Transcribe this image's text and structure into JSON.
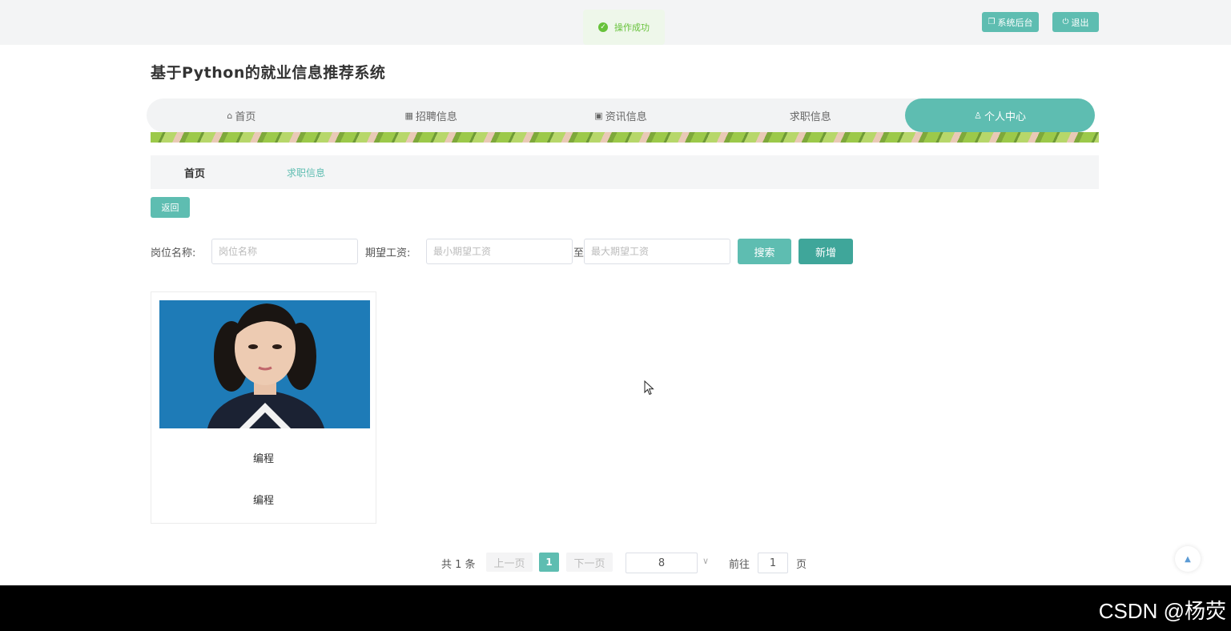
{
  "toast": {
    "text": "操作成功"
  },
  "header": {
    "admin_label": "系统后台",
    "logout_label": "退出"
  },
  "site_title": "基于Python的就业信息推荐系统",
  "nav": {
    "items": [
      {
        "label": "首页",
        "icon": "home-icon"
      },
      {
        "label": "招聘信息",
        "icon": "grid-icon"
      },
      {
        "label": "资讯信息",
        "icon": "briefcase-icon"
      },
      {
        "label": "求职信息",
        "icon": ""
      },
      {
        "label": "个人中心",
        "icon": "user-icon"
      }
    ],
    "active_index": 4,
    "active_color": "#5ebdb1"
  },
  "breadcrumb": {
    "home": "首页",
    "current": "求职信息"
  },
  "back_label": "返回",
  "search": {
    "job_label": "岗位名称:",
    "job_placeholder": "岗位名称",
    "salary_label": "期望工资:",
    "min_placeholder": "最小期望工资",
    "to_label": "至",
    "max_placeholder": "最大期望工资",
    "search_label": "搜索",
    "add_label": "新增"
  },
  "cards": [
    {
      "line1": "编程",
      "line2": "编程"
    }
  ],
  "pagination": {
    "total": "共 1 条",
    "prev": "上一页",
    "current": "1",
    "next": "下一页",
    "page_size": "8",
    "goto_label": "前往",
    "goto_value": "1",
    "page_suffix": "页"
  },
  "watermark": "CSDN @杨荧"
}
